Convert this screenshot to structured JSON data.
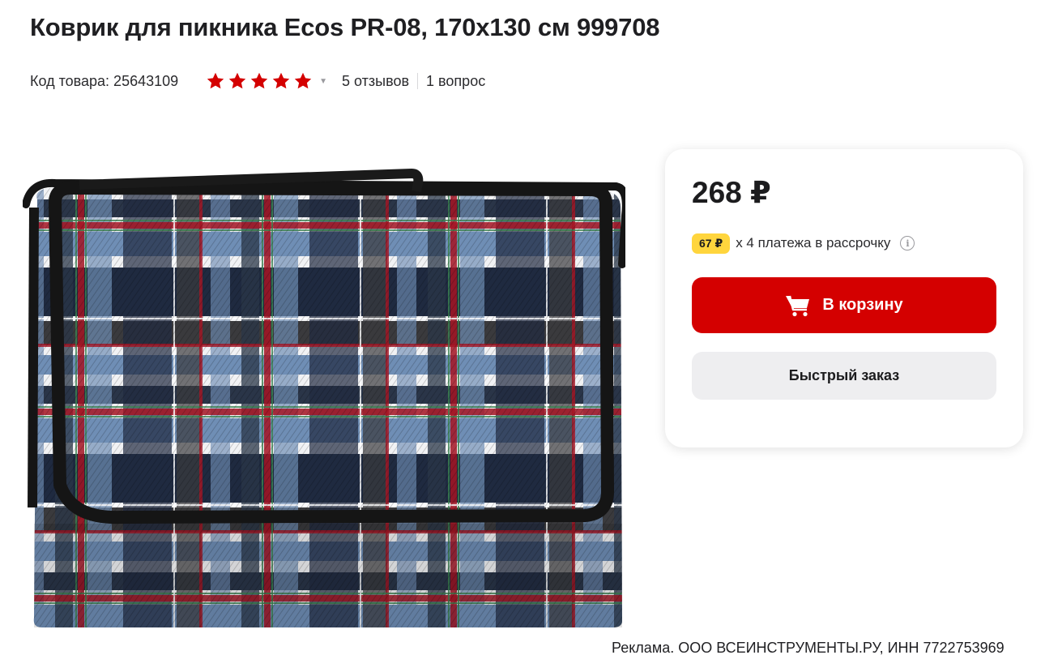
{
  "product": {
    "title": "Коврик для пикника Ecos PR-08, 170х130 см 999708",
    "code_label": "Код товара: 25643109"
  },
  "rating": {
    "stars": 5,
    "max_stars": 5,
    "star_color": "#d40000",
    "reviews_label": "5 отзывов",
    "questions_label": "1 вопрос"
  },
  "buy_card": {
    "price": "268 ₽",
    "installment_amount": "67 ₽",
    "installment_text": "х 4 платежа в рассрочку",
    "info_icon": "i",
    "cart_button_label": "В корзину",
    "quick_order_label": "Быстрый заказ",
    "accent_color": "#d40000",
    "badge_color": "#ffd53d"
  },
  "image": {
    "alt": "product-photo-plaid-picnic-mat"
  },
  "footer": {
    "ad_text": "Реклама. ООО ВСЕИНСТРУМЕНТЫ.РУ, ИНН 7722753969"
  },
  "icons": {
    "cart": "cart-icon",
    "star": "star-icon",
    "chevron": "chevron-down-icon",
    "info": "info-icon"
  }
}
